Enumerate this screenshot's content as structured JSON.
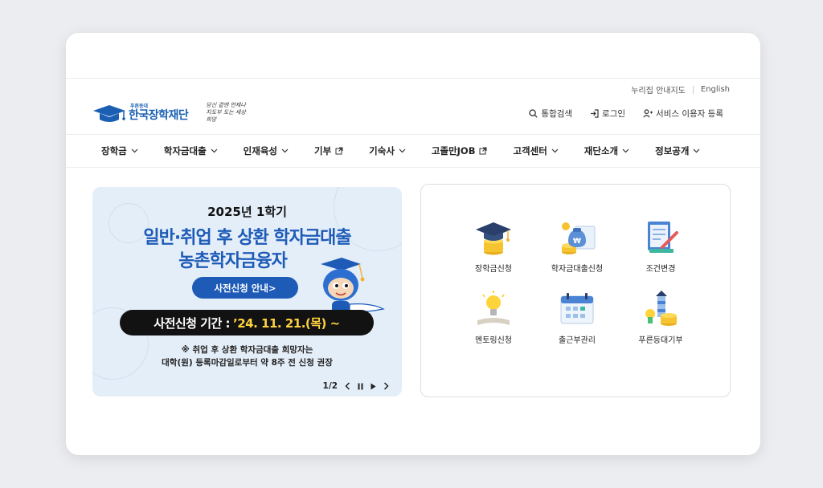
{
  "utility": {
    "sitemap": "누리집 안내지도",
    "english": "English"
  },
  "logo": {
    "small": "푸른등대",
    "main": "한국장학재단",
    "slogan": "당신 곁엔 언제나 지도부 도는 세상 희망"
  },
  "actions": {
    "search": "통합검색",
    "login": "로그인",
    "register": "서비스 이용자 등록"
  },
  "nav": [
    {
      "label": "장학금",
      "icon": "chevron-down-icon"
    },
    {
      "label": "학자금대출",
      "icon": "chevron-down-icon"
    },
    {
      "label": "인재육성",
      "icon": "chevron-down-icon"
    },
    {
      "label": "기부",
      "icon": "external-link-icon"
    },
    {
      "label": "기숙사",
      "icon": "chevron-down-icon"
    },
    {
      "label": "고졸만JOB",
      "icon": "external-link-icon"
    },
    {
      "label": "고객센터",
      "icon": "chevron-down-icon"
    },
    {
      "label": "재단소개",
      "icon": "chevron-down-icon"
    },
    {
      "label": "정보공개",
      "icon": "chevron-down-icon"
    }
  ],
  "banner": {
    "subtitle": "2025년 1학기",
    "title1": "일반·취업 후 상환 학자금대출",
    "title2": "농촌학자금융자",
    "button": "사전신청 안내>",
    "period_label": "사전신청 기간 :",
    "period_date": "’24. 11. 21.(목) ~",
    "note1": "※ 취업 후 상환 학자금대출 희망자는",
    "note2": "대학(원) 등록마감일로부터 약 8주 전 신청 권장",
    "pager": "1/2"
  },
  "quick": [
    {
      "label": "장학금신청",
      "icon": "graduation-cap-icon"
    },
    {
      "label": "학자금대출신청",
      "icon": "loan-money-bag-icon"
    },
    {
      "label": "조건변경",
      "icon": "document-pen-icon"
    },
    {
      "label": "멘토링신청",
      "icon": "lightbulb-book-icon"
    },
    {
      "label": "출근부관리",
      "icon": "calendar-icon"
    },
    {
      "label": "푸른등대기부",
      "icon": "lighthouse-coins-icon"
    }
  ]
}
